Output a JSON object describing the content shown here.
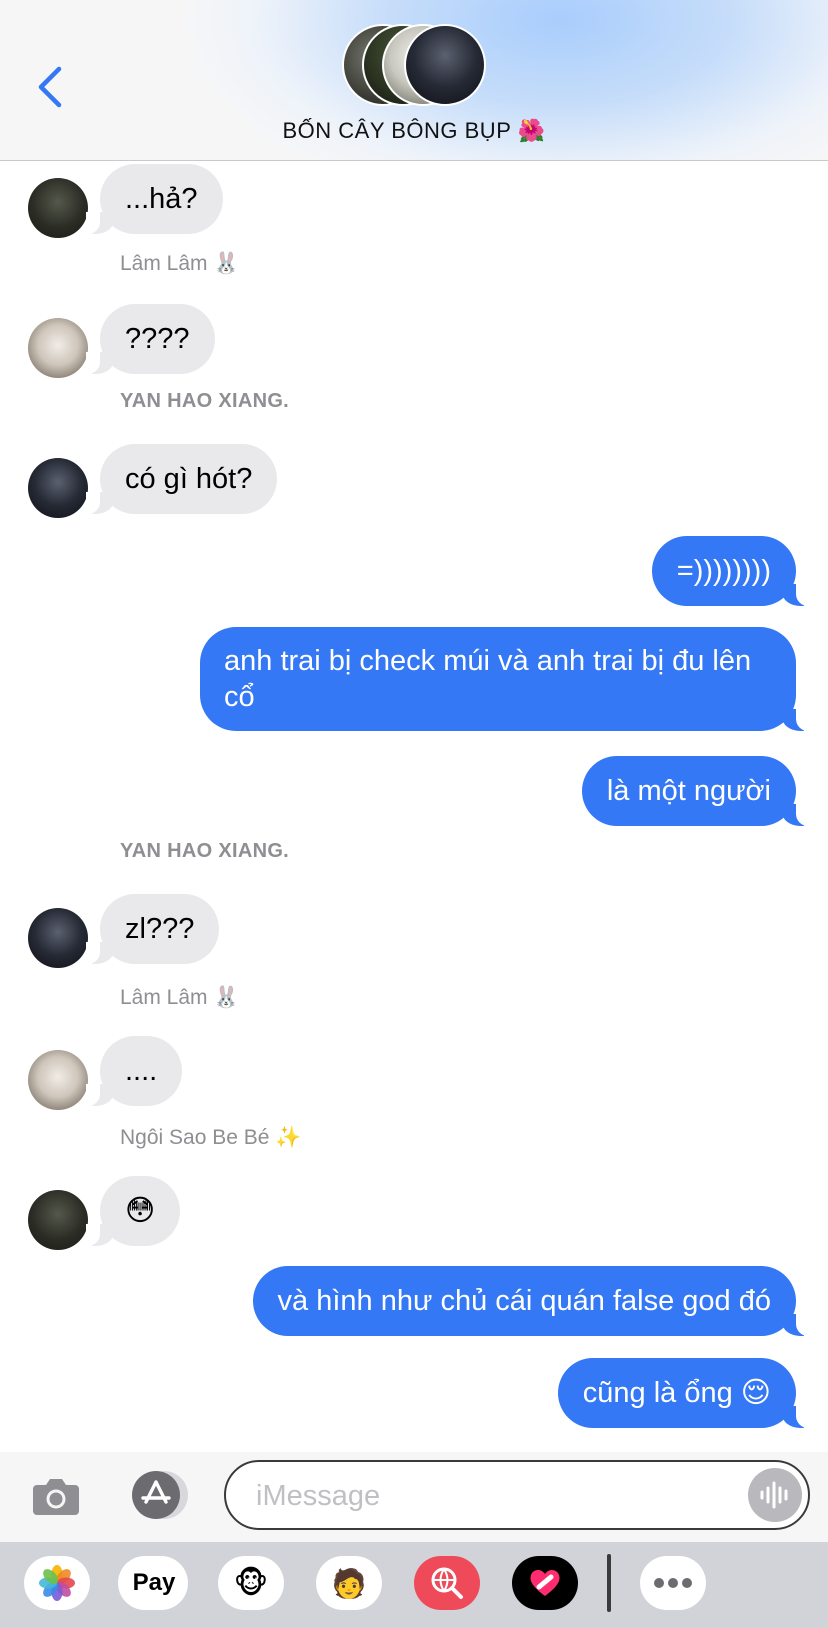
{
  "header": {
    "group_name": "BỐN CÂY BÔNG BỤP 🌺"
  },
  "messages": [
    {
      "sender": "",
      "text": "...hả?",
      "direction": "in"
    },
    {
      "sender": "Lâm Lâm 🐰",
      "text": "????",
      "direction": "in"
    },
    {
      "sender": "YAN HAO XIANG.",
      "text": "có gì hót?",
      "direction": "in"
    },
    {
      "sender": "",
      "text": "=))))))))",
      "direction": "out"
    },
    {
      "sender": "",
      "text": "anh trai bị check múi và anh trai bị đu lên cổ",
      "direction": "out"
    },
    {
      "sender": "",
      "text": "là một người",
      "direction": "out"
    },
    {
      "sender": "YAN HAO XIANG.",
      "text": "zl???",
      "direction": "in"
    },
    {
      "sender": "Lâm Lâm 🐰",
      "text": "....",
      "direction": "in"
    },
    {
      "sender": "Ngôi Sao Be Bé ✨",
      "text": "😳",
      "direction": "in"
    },
    {
      "sender": "",
      "text": "và hình như chủ cái quán false god đó",
      "direction": "out"
    },
    {
      "sender": "",
      "text": "cũng là ổng 😌",
      "direction": "out"
    }
  ],
  "input": {
    "placeholder": "iMessage",
    "value": ""
  },
  "apps": {
    "photos": "photos-icon",
    "apple_pay_label": "Pay",
    "memoji": "🐵",
    "memoji_stickers": "🧑",
    "images_search": "globe-search-icon",
    "digital_touch": "heart-icon",
    "more": "more-icon"
  },
  "colors": {
    "outgoing_bubble": "#3478f6",
    "incoming_bubble": "#e9e9eb",
    "accent": "#3478f6"
  }
}
